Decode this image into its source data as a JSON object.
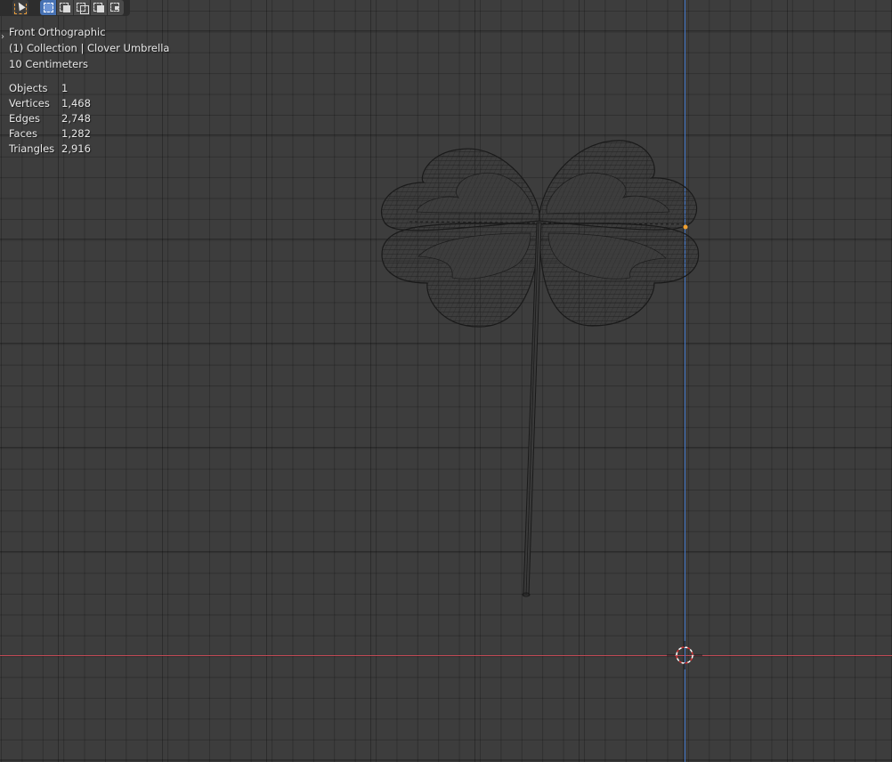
{
  "viewport": {
    "view_name": "Front Orthographic",
    "collection_label": "(1) Collection | Clover Umbrella",
    "grid_scale": "10 Centimeters",
    "background_color": "#3d3d3d",
    "x_axis_color": "#c24a55",
    "z_axis_color": "#3f74c8"
  },
  "toolbar": {
    "select_tool_icon": "select-box-icon",
    "modes": [
      {
        "name": "set-new-selection",
        "icon": "select-new-icon",
        "active": true
      },
      {
        "name": "extend-selection",
        "icon": "select-extend-icon",
        "active": false
      },
      {
        "name": "subtract-selection",
        "icon": "select-subtract-icon",
        "active": false
      },
      {
        "name": "invert-selection",
        "icon": "select-difference-icon",
        "active": false
      },
      {
        "name": "intersect-selection",
        "icon": "select-intersect-icon",
        "active": false
      }
    ]
  },
  "statistics": {
    "objects_label": "Objects",
    "objects_value": "1",
    "vertices_label": "Vertices",
    "vertices_value": "1,468",
    "edges_label": "Edges",
    "edges_value": "2,748",
    "faces_label": "Faces",
    "faces_value": "1,282",
    "triangles_label": "Triangles",
    "triangles_value": "2,916"
  },
  "object": {
    "icon": "clover-umbrella-wireframe",
    "origin_color": "#f0a030",
    "wire_color": "#1a1a1a"
  }
}
